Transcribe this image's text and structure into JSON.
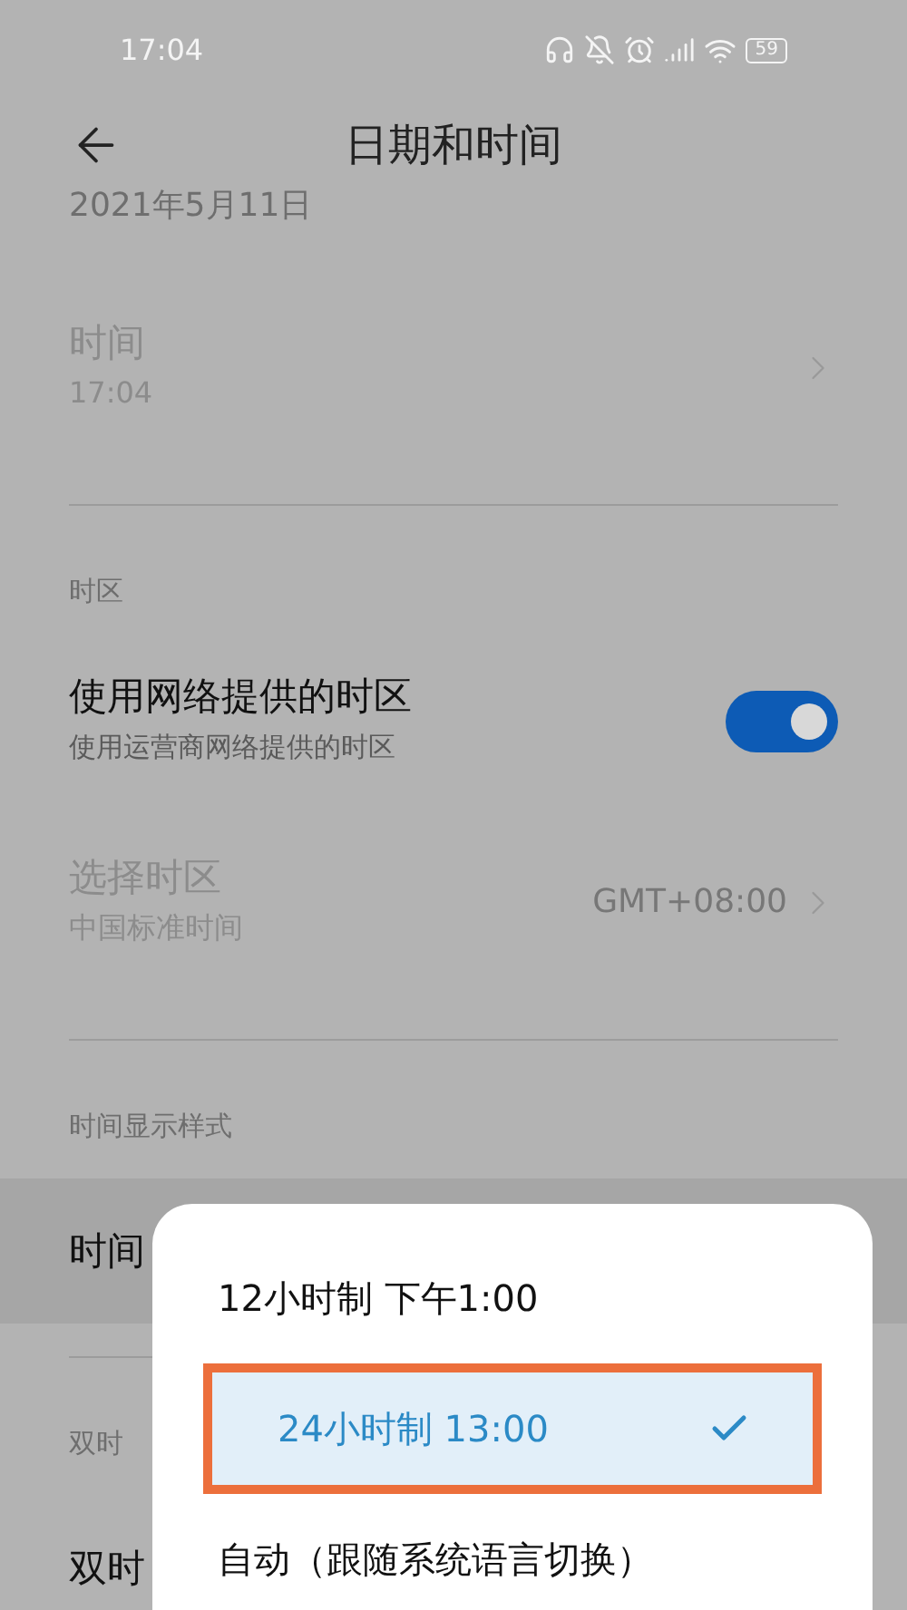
{
  "status_bar": {
    "time": "17:04",
    "battery": "59"
  },
  "header": {
    "title": "日期和时间"
  },
  "items": [
    {
      "kind": "text",
      "text": "2021年5月11日"
    },
    {
      "kind": "nav",
      "title": "时间",
      "subtitle": "17:04",
      "disabled": true,
      "pressed": false
    },
    {
      "kind": "section",
      "label": "时区"
    },
    {
      "kind": "toggle",
      "title": "使用网络提供的时区",
      "subtitle": "使用运营商网络提供的时区",
      "on": true
    },
    {
      "kind": "nav",
      "title": "选择时区",
      "subtitle": "中国标准时间",
      "value": "GMT+08:00",
      "disabled": true,
      "pressed": false
    },
    {
      "kind": "section",
      "label": "时间显示样式"
    },
    {
      "kind": "nav",
      "title": "时间",
      "disabled": false,
      "pressed": true
    },
    {
      "kind": "section",
      "label": "双时"
    },
    {
      "kind": "nav",
      "title": "双时",
      "disabled": false,
      "pressed": false
    }
  ],
  "popup": {
    "options": [
      {
        "label": "12小时制 下午1:00",
        "selected": false,
        "highlighted": false
      },
      {
        "label": "24小时制 13:00",
        "selected": true,
        "highlighted": true
      },
      {
        "label": "自动（跟随系统语言切换）",
        "selected": false,
        "highlighted": false
      }
    ]
  }
}
